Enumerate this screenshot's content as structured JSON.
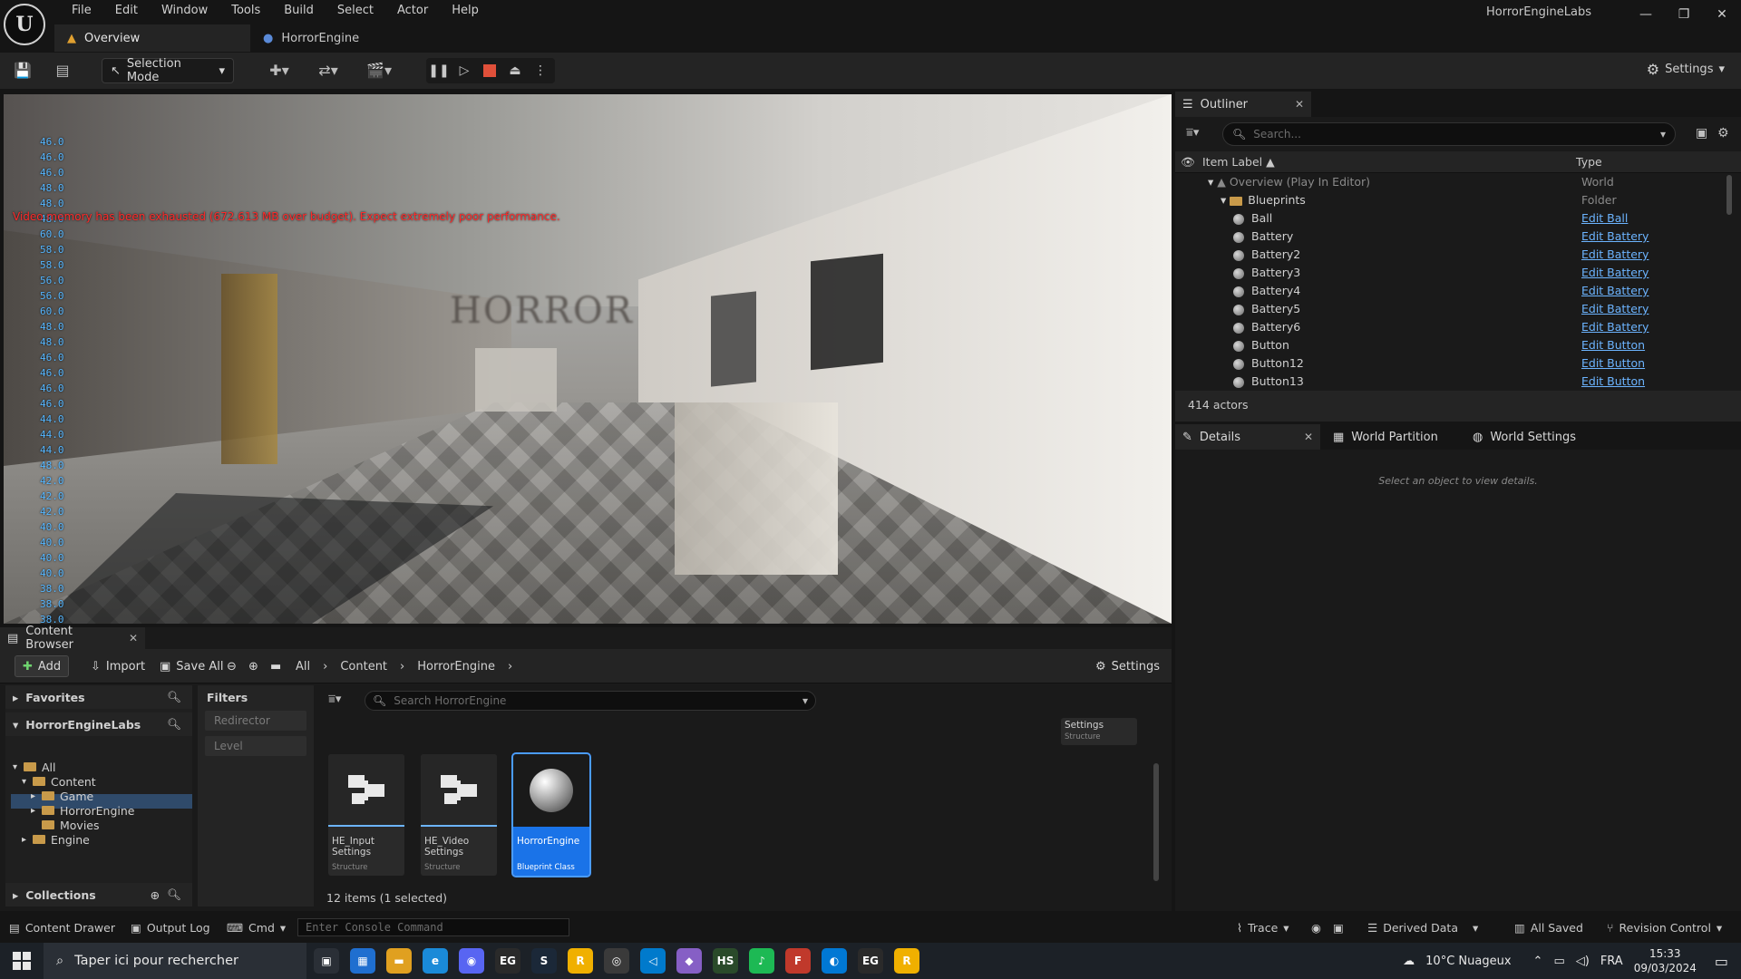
{
  "app": {
    "logo_text": "U",
    "menu": [
      "File",
      "Edit",
      "Window",
      "Tools",
      "Build",
      "Select",
      "Actor",
      "Help"
    ],
    "tabs": [
      {
        "label": "Overview",
        "active": true
      },
      {
        "label": "HorrorEngine",
        "active": false
      }
    ],
    "project_name": "HorrorEngineLabs",
    "window_controls": [
      "—",
      "❐",
      "✕"
    ]
  },
  "toolbar": {
    "selection_mode": "Selection Mode",
    "settings": "Settings"
  },
  "viewport": {
    "fps_values": [
      "46.0",
      "46.0",
      "46.0",
      "48.0",
      "48.0",
      "48.0",
      "60.0",
      "58.0",
      "58.0",
      "56.0",
      "56.0",
      "60.0",
      "48.0",
      "48.0",
      "46.0",
      "46.0",
      "46.0",
      "46.0",
      "44.0",
      "44.0",
      "44.0",
      "48.0",
      "42.0",
      "42.0",
      "42.0",
      "40.0",
      "40.0",
      "40.0",
      "40.0",
      "38.0",
      "38.0",
      "38.0"
    ],
    "warning": "Video memory has been exhausted (672.613 MB over budget). Expect extremely poor performance.",
    "sign_text": "HORROR"
  },
  "outliner": {
    "tab_label": "Outliner",
    "search_placeholder": "Search...",
    "col_label": "Item Label ▲",
    "col_type": "Type",
    "rows": [
      {
        "label": "Overview (Play In Editor)",
        "type": "World",
        "indent": 0,
        "kind": "world",
        "link": false
      },
      {
        "label": "Blueprints",
        "type": "Folder",
        "indent": 1,
        "kind": "folder",
        "link": false
      },
      {
        "label": "Ball",
        "type": "Edit Ball",
        "indent": 2,
        "kind": "actor",
        "link": true
      },
      {
        "label": "Battery",
        "type": "Edit Battery",
        "indent": 2,
        "kind": "actor",
        "link": true
      },
      {
        "label": "Battery2",
        "type": "Edit Battery",
        "indent": 2,
        "kind": "actor",
        "link": true
      },
      {
        "label": "Battery3",
        "type": "Edit Battery",
        "indent": 2,
        "kind": "actor",
        "link": true
      },
      {
        "label": "Battery4",
        "type": "Edit Battery",
        "indent": 2,
        "kind": "actor",
        "link": true
      },
      {
        "label": "Battery5",
        "type": "Edit Battery",
        "indent": 2,
        "kind": "actor",
        "link": true
      },
      {
        "label": "Battery6",
        "type": "Edit Battery",
        "indent": 2,
        "kind": "actor",
        "link": true
      },
      {
        "label": "Button",
        "type": "Edit Button",
        "indent": 2,
        "kind": "actor",
        "link": true
      },
      {
        "label": "Button12",
        "type": "Edit Button",
        "indent": 2,
        "kind": "actor",
        "link": true
      },
      {
        "label": "Button13",
        "type": "Edit Button",
        "indent": 2,
        "kind": "actor",
        "link": true
      }
    ],
    "count": "414 actors"
  },
  "details": {
    "tabs": [
      "Details",
      "World Partition",
      "World Settings"
    ],
    "empty": "Select an object to view details."
  },
  "content_browser": {
    "tab_label": "Content Browser",
    "add": "Add",
    "import": "Import",
    "save_all": "Save All",
    "crumbs": [
      "All",
      "Content",
      "HorrorEngine"
    ],
    "settings": "Settings",
    "favorites": "Favorites",
    "project": "HorrorEngineLabs",
    "tree": [
      {
        "label": "All",
        "indent": 0
      },
      {
        "label": "Content",
        "indent": 1
      },
      {
        "label": "Game",
        "indent": 2
      },
      {
        "label": "HorrorEngine",
        "indent": 2
      },
      {
        "label": "Movies",
        "indent": 2
      },
      {
        "label": "Engine",
        "indent": 1
      }
    ],
    "collections": "Collections",
    "filters_title": "Filters",
    "filters": [
      "Redirector",
      "Level"
    ],
    "search_placeholder": "Search HorrorEngine",
    "partial_asset": {
      "name": "Settings",
      "kind": "Structure"
    },
    "assets": [
      {
        "name": "HE_Input Settings",
        "kind": "Structure"
      },
      {
        "name": "HE_Video Settings",
        "kind": "Structure"
      },
      {
        "name": "HorrorEngine",
        "kind": "Blueprint Class"
      }
    ],
    "count": "12 items (1 selected)"
  },
  "statusbar": {
    "content_drawer": "Content Drawer",
    "output_log": "Output Log",
    "cmd": "Cmd",
    "console_placeholder": "Enter Console Command",
    "trace": "Trace",
    "derived_data": "Derived Data",
    "all_saved": "All Saved",
    "revision_control": "Revision Control"
  },
  "taskbar": {
    "search": "Taper ici pour rechercher",
    "apps": [
      {
        "label": "▣",
        "color": "#2a2f36"
      },
      {
        "label": "▦",
        "color": "#1f6fd0"
      },
      {
        "label": "▬",
        "color": "#e0a020"
      },
      {
        "label": "e",
        "color": "#1a8ad8"
      },
      {
        "label": "◉",
        "color": "#5865f2"
      },
      {
        "label": "EG",
        "color": "#2a2a2a"
      },
      {
        "label": "S",
        "color": "#1b2838"
      },
      {
        "label": "R",
        "color": "#f0b000"
      },
      {
        "label": "◎",
        "color": "#3a3a3a"
      },
      {
        "label": "◁",
        "color": "#007acc"
      },
      {
        "label": "◆",
        "color": "#865fc5"
      },
      {
        "label": "HS",
        "color": "#2a4a2a"
      },
      {
        "label": "♪",
        "color": "#1db954"
      },
      {
        "label": "F",
        "color": "#c0392b"
      },
      {
        "label": "◐",
        "color": "#0078d4"
      },
      {
        "label": "EG",
        "color": "#2a2a2a"
      },
      {
        "label": "R",
        "color": "#f0b000"
      }
    ],
    "weather": "10°C  Nuageux",
    "lang": "FRA",
    "time": "15:33",
    "date": "09/03/2024"
  }
}
